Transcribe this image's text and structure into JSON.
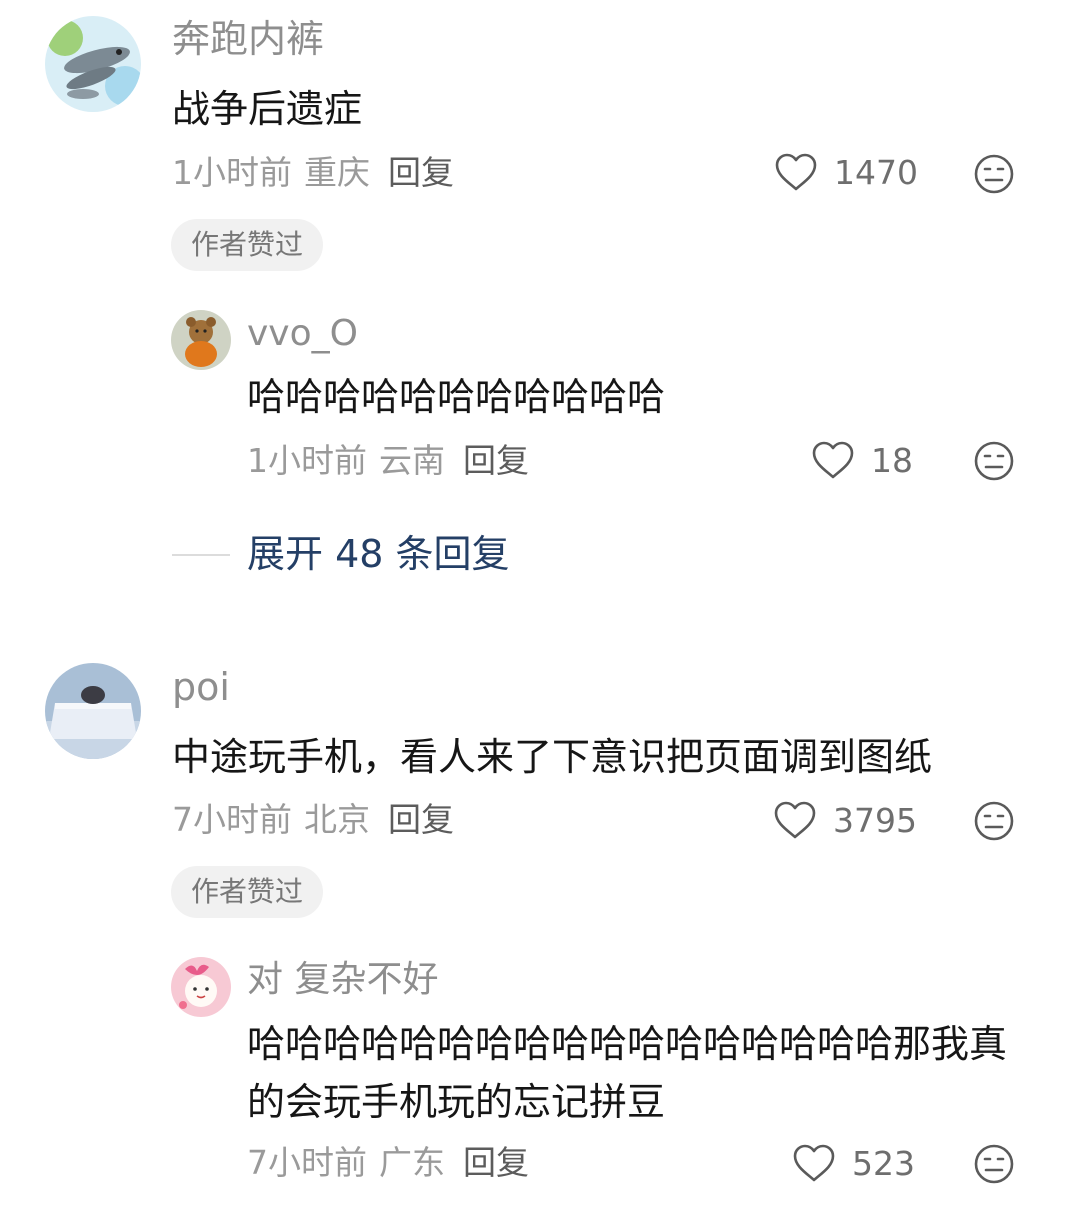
{
  "comments": [
    {
      "username": "奔跑内裤",
      "content": "战争后遗症",
      "time": "1小时前",
      "location": "重庆",
      "reply_label": "回复",
      "likes": "1470",
      "badge": "作者赞过",
      "reply": {
        "username": "vvo_O",
        "content": "哈哈哈哈哈哈哈哈哈哈哈",
        "time": "1小时前",
        "location": "云南",
        "reply_label": "回复",
        "likes": "18"
      },
      "expand_label": "展开 48 条回复"
    },
    {
      "username": "poi",
      "content": "中途玩手机，看人来了下意识把页面调到图纸",
      "time": "7小时前",
      "location": "北京",
      "reply_label": "回复",
      "likes": "3795",
      "badge": "作者赞过",
      "reply": {
        "username": "对 复杂不好",
        "content": "哈哈哈哈哈哈哈哈哈哈哈哈哈哈哈哈哈那我真的会玩手机玩的忘记拼豆",
        "time": "7小时前",
        "location": "广东",
        "reply_label": "回复",
        "likes": "523"
      }
    }
  ],
  "icons": {
    "like": "heart-outline-icon",
    "dislike": "meh-face-icon"
  },
  "colors": {
    "expand_link": "#243f66",
    "meta_gray": "#9a9a9a",
    "badge_bg": "#f1f1f1"
  }
}
